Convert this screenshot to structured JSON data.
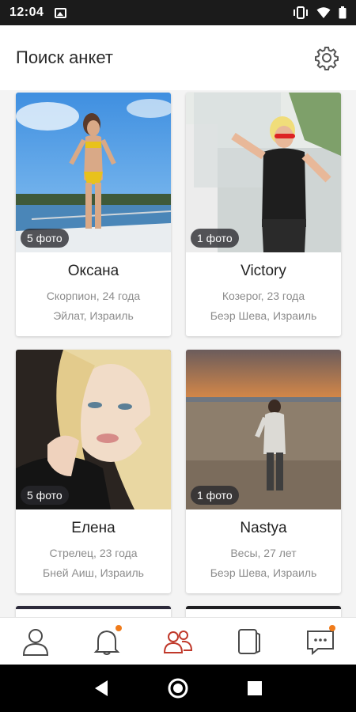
{
  "status_bar": {
    "time": "12:04",
    "icons": [
      "image-icon",
      "vibrate-icon",
      "wifi-icon",
      "battery-icon"
    ]
  },
  "header": {
    "title": "Поиск анкет",
    "settings_icon": "gear-icon"
  },
  "profiles": [
    {
      "name": "Оксана",
      "sign_age": "Скорпион, 24 года",
      "location": "Эйлат, Израиль",
      "photo_count": "5 фото"
    },
    {
      "name": "Victory",
      "sign_age": "Козерог, 23 года",
      "location": "Беэр Шева, Израиль",
      "photo_count": "1 фото"
    },
    {
      "name": "Елена",
      "sign_age": "Стрелец, 23 года",
      "location": "Бней Аиш, Израиль",
      "photo_count": "5 фото"
    },
    {
      "name": "Nastya",
      "sign_age": "Весы, 27 лет",
      "location": "Беэр Шева, Израиль",
      "photo_count": "1 фото"
    }
  ],
  "bottom_nav": {
    "items": [
      {
        "icon": "profile-icon",
        "badge": false
      },
      {
        "icon": "bell-icon",
        "badge": true
      },
      {
        "icon": "people-icon",
        "badge": false,
        "active": true
      },
      {
        "icon": "cards-icon",
        "badge": false
      },
      {
        "icon": "chat-icon",
        "badge": true
      }
    ],
    "active_color": "#c0392b",
    "badge_color": "#f07b1a"
  },
  "android_nav": [
    "back-icon",
    "home-icon",
    "recents-icon"
  ]
}
